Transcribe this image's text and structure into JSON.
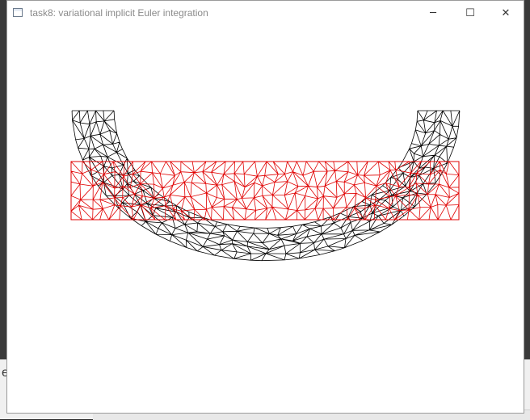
{
  "window": {
    "title": "task8: variational implicit Euler integration",
    "minimize_glyph": "─",
    "maximize_glyph": "☐",
    "close_glyph": "✕"
  },
  "background": {
    "partial_glyph": "e"
  },
  "scene": {
    "rest_mesh_color": "#e00000",
    "deformed_mesh_color": "#000000"
  }
}
